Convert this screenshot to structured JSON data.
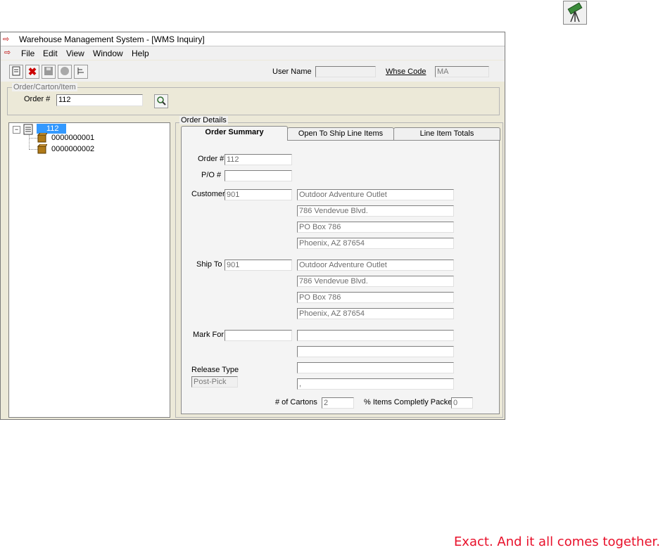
{
  "window": {
    "title": "Warehouse Management System - [WMS Inquiry]"
  },
  "menu": [
    "File",
    "Edit",
    "View",
    "Window",
    "Help"
  ],
  "header": {
    "user_name_label": "User Name",
    "user_name_value": "",
    "whse_code_label": "Whse Code",
    "whse_code_value": "MA"
  },
  "search": {
    "group_title": "Order/Carton/Item",
    "order_label": "Order #",
    "order_value": "112"
  },
  "tree": {
    "root": "112",
    "children": [
      "0000000001",
      "0000000002"
    ]
  },
  "details": {
    "group_title": "Order Details",
    "tabs": [
      "Order Summary",
      "Open To Ship Line Items",
      "Line Item Totals"
    ],
    "active_tab": "Order Summary",
    "order_label": "Order #",
    "order_value": "112",
    "po_label": "P/O #",
    "po_value": "",
    "customer_label": "Customer",
    "customer_code": "901",
    "customer_lines": [
      "Outdoor Adventure Outlet",
      "786 Vendevue Blvd.",
      "PO Box 786",
      "Phoenix, AZ 87654"
    ],
    "ship_to_label": "Ship To",
    "ship_to_code": "901",
    "ship_to_lines": [
      "Outdoor Adventure Outlet",
      "786 Vendevue Blvd.",
      "PO Box 786",
      "Phoenix, AZ 87654"
    ],
    "mark_for_label": "Mark For",
    "mark_for_code": "",
    "mark_for_lines": [
      "",
      "",
      "",
      ","
    ],
    "release_type_label": "Release Type",
    "release_type_value": "Post-Pick",
    "cartons_label": "# of Cartons",
    "cartons_value": "2",
    "packed_label": "% Items Completly Packed",
    "packed_value": "0"
  },
  "slogan": "Exact. And it all comes together."
}
